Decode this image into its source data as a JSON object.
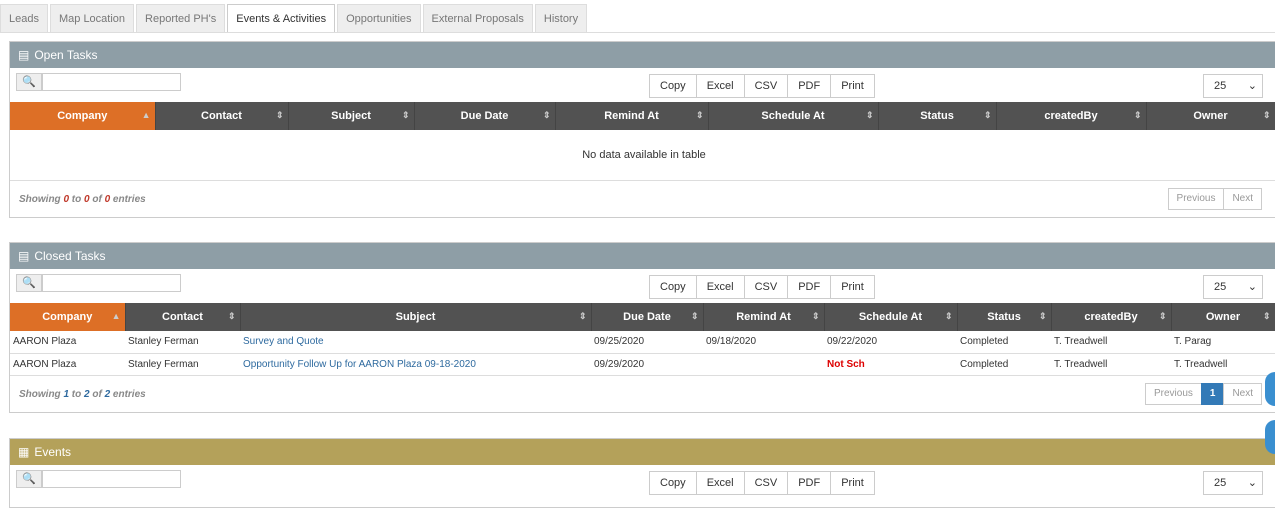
{
  "tabs": [
    "Leads",
    "Map Location",
    "Reported PH's",
    "Events & Activities",
    "Opportunities",
    "External Proposals",
    "History"
  ],
  "active_tab": "Events & Activities",
  "toolbar": {
    "copy": "Copy",
    "excel": "Excel",
    "csv": "CSV",
    "pdf": "PDF",
    "print": "Print",
    "page_size": "25"
  },
  "open_tasks": {
    "title": "Open Tasks",
    "columns": [
      "Company",
      "Contact",
      "Subject",
      "Due Date",
      "Remind At",
      "Schedule At",
      "Status",
      "createdBy",
      "Owner"
    ],
    "empty_message": "No data available in table",
    "info": {
      "prefix": "Showing ",
      "from": "0",
      "to": "0",
      "of": "0",
      "suffix": " entries"
    },
    "pager": {
      "previous": "Previous",
      "next": "Next"
    }
  },
  "closed_tasks": {
    "title": "Closed Tasks",
    "columns": [
      "Company",
      "Contact",
      "Subject",
      "Due Date",
      "Remind At",
      "Schedule At",
      "Status",
      "createdBy",
      "Owner"
    ],
    "rows": [
      {
        "company": "AARON Plaza",
        "contact": "Stanley Ferman",
        "subject": "Survey and Quote",
        "due": "09/25/2020",
        "remind": "09/18/2020",
        "schedule": "09/22/2020",
        "status": "Completed",
        "created_by": "T. Treadwell",
        "owner": "T. Parag"
      },
      {
        "company": "AARON Plaza",
        "contact": "Stanley Ferman",
        "subject": "Opportunity Follow Up for AARON Plaza 09-18-2020",
        "due": "09/29/2020",
        "remind": "",
        "schedule": "Not Sch",
        "status": "Completed",
        "created_by": "T. Treadwell",
        "owner": "T. Treadwell"
      }
    ],
    "info": {
      "prefix": "Showing ",
      "from": "1",
      "to": "2",
      "of": "2",
      "suffix": " entries"
    },
    "pager": {
      "previous": "Previous",
      "page": "1",
      "next": "Next"
    }
  },
  "events": {
    "title": "Events"
  },
  "colors": {
    "panel_header": "#8e9ea6",
    "events_header": "#b4a15a",
    "sorted_column": "#dd6f26",
    "table_header": "#525252"
  }
}
